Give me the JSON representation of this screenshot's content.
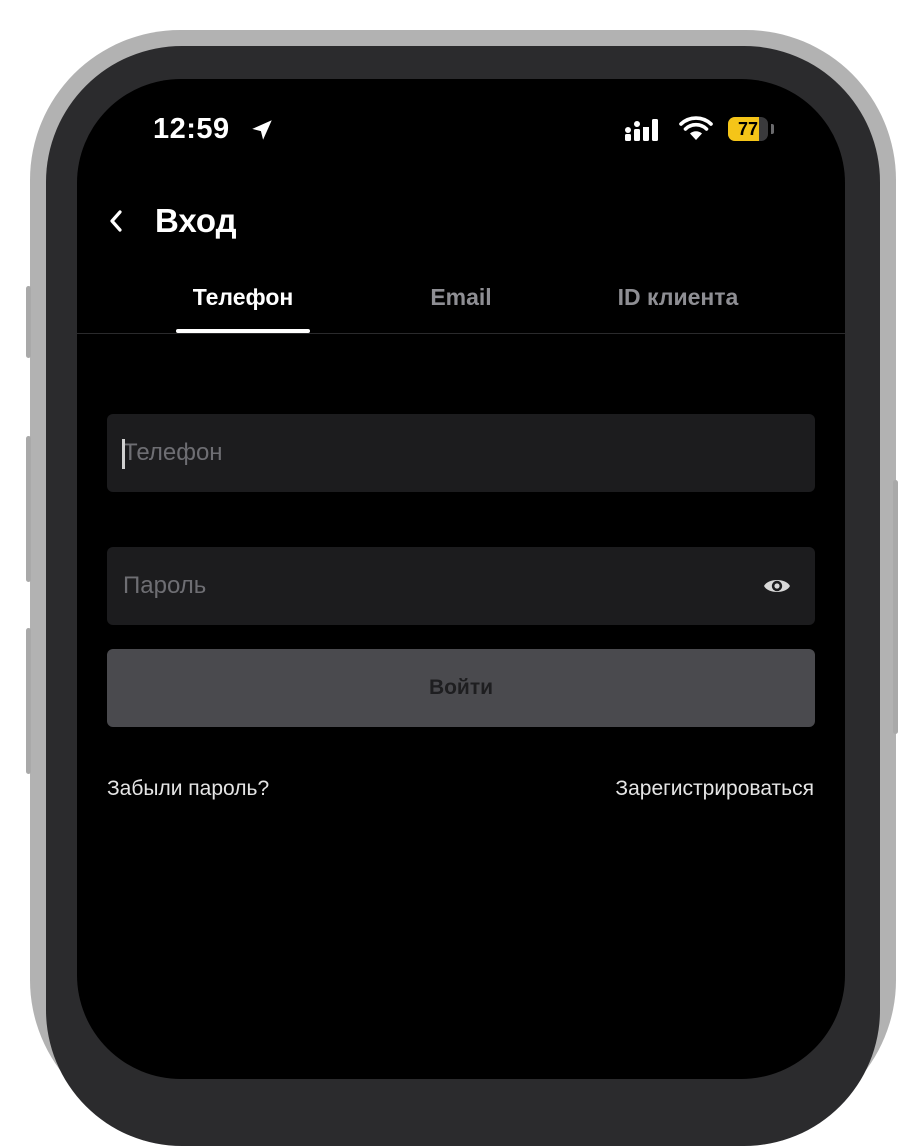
{
  "status_bar": {
    "time": "12:59",
    "battery_level": "77",
    "battery_fraction": 0.77,
    "icons": [
      "location-arrow-icon",
      "cellular-signal-icon",
      "wifi-icon",
      "battery-icon"
    ]
  },
  "header": {
    "back_icon": "chevron-left-icon",
    "title": "Вход"
  },
  "tabs": [
    {
      "label": "Телефон",
      "active": true
    },
    {
      "label": "Email",
      "active": false
    },
    {
      "label": "ID клиента",
      "active": false
    }
  ],
  "form": {
    "phone": {
      "value": "",
      "placeholder": "Телефон"
    },
    "password": {
      "value": "",
      "placeholder": "Пароль",
      "toggle_icon": "eye-icon"
    },
    "submit_label": "Войти"
  },
  "links": {
    "forgot_password": "Забыли пароль?",
    "register": "Зарегистрироваться"
  },
  "colors": {
    "background": "#000000",
    "field_background": "#1c1c1e",
    "button_background": "#4a4a4e",
    "battery": "#f5c518",
    "inactive_tab": "#8e8e93"
  }
}
